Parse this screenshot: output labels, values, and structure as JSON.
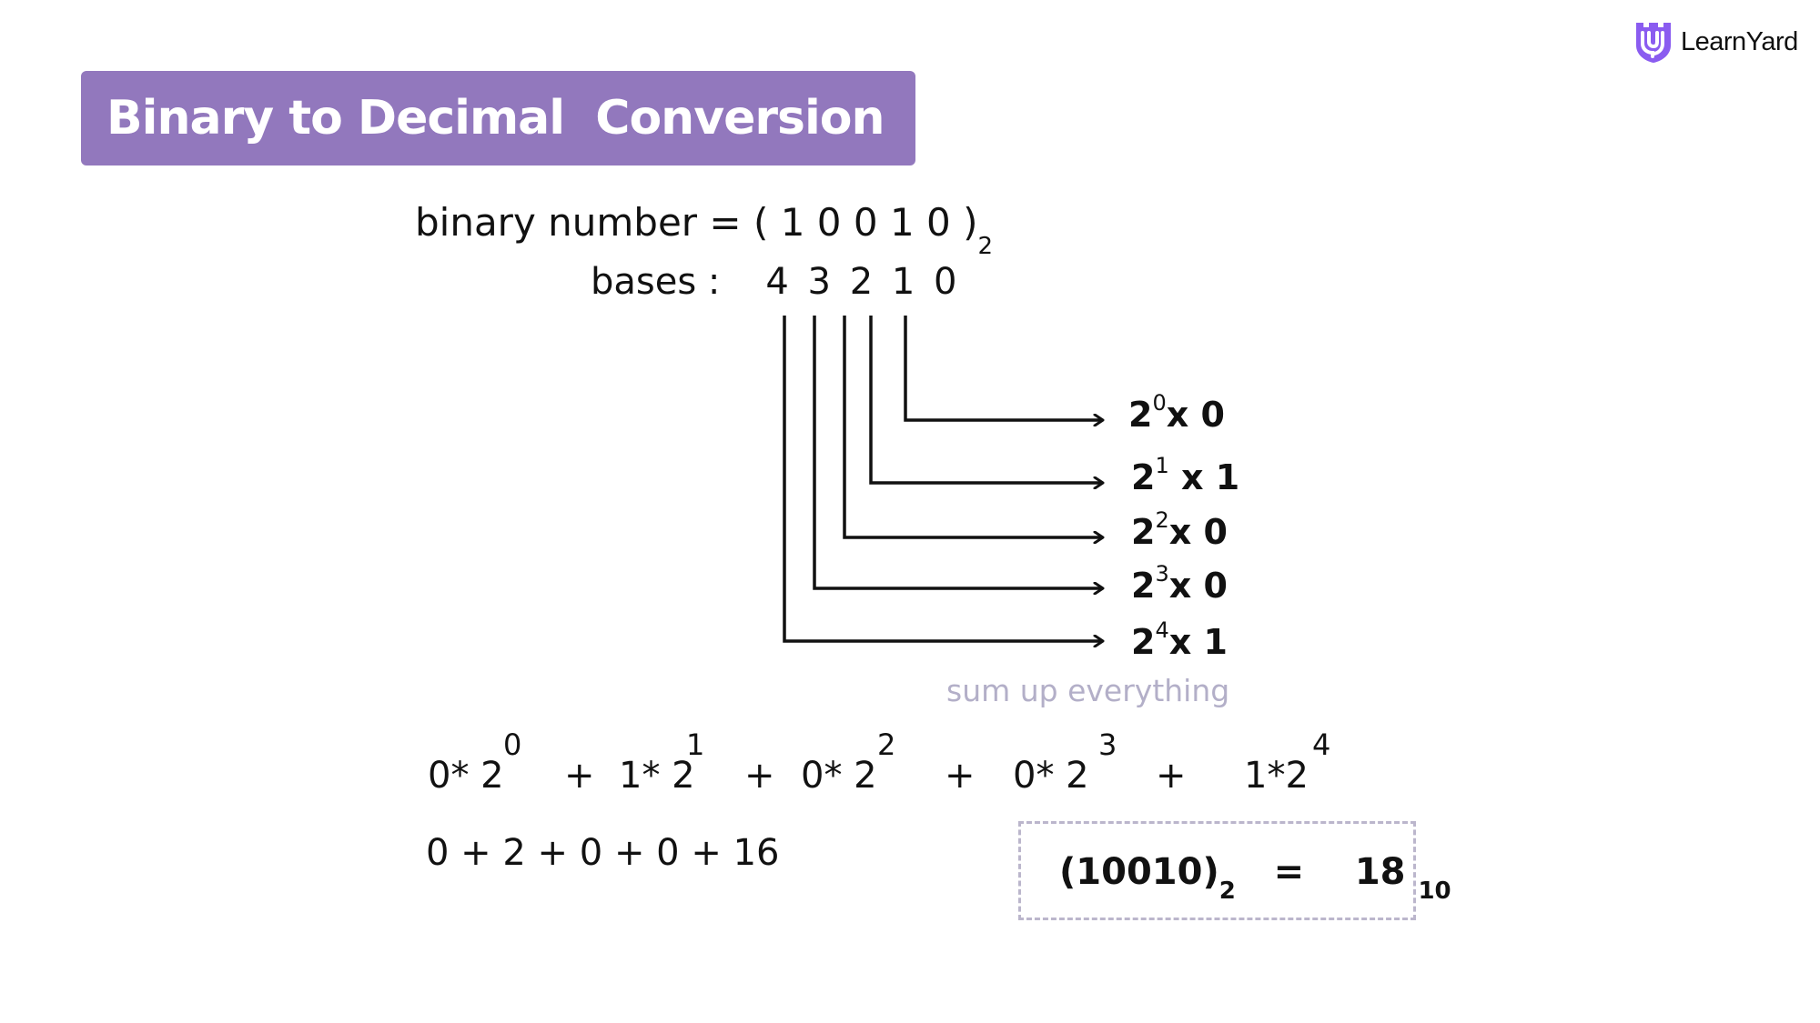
{
  "brand": {
    "logo_icon": "learnyard-shield-icon",
    "name": "LearnYard",
    "accent_color": "#9278bd"
  },
  "title": "Binary to Decimal  Conversion",
  "binary_line": {
    "label": "binary number = ",
    "value": "( 1 0 0 1 0 )",
    "base_subscript": "2"
  },
  "bases_line": {
    "label": "bases :",
    "digits": "4 3 2 1 0"
  },
  "terms": [
    {
      "base": "2",
      "exponent": "0",
      "op": "x",
      "bit": "0"
    },
    {
      "base": "2",
      "exponent": "1",
      "op": "x",
      "bit": "1"
    },
    {
      "base": "2",
      "exponent": "2",
      "op": "x",
      "bit": "0"
    },
    {
      "base": "2",
      "exponent": "3",
      "op": "x",
      "bit": "0"
    },
    {
      "base": "2",
      "exponent": "4",
      "op": "x",
      "bit": "1"
    }
  ],
  "hint": "sum up everything",
  "expansion": {
    "parts": [
      "0* 2",
      "+",
      "1* 2",
      "+",
      "0* 2",
      "+",
      "0* 2",
      "+",
      "1*2"
    ],
    "exponents": [
      "0",
      "1",
      "2",
      "3",
      "4"
    ]
  },
  "sum_line": "0 + 2 + 0 + 0 + 16",
  "result": {
    "binary": "(10010)",
    "binary_base": "2",
    "equals": "=",
    "decimal": "18",
    "decimal_base": "10"
  }
}
